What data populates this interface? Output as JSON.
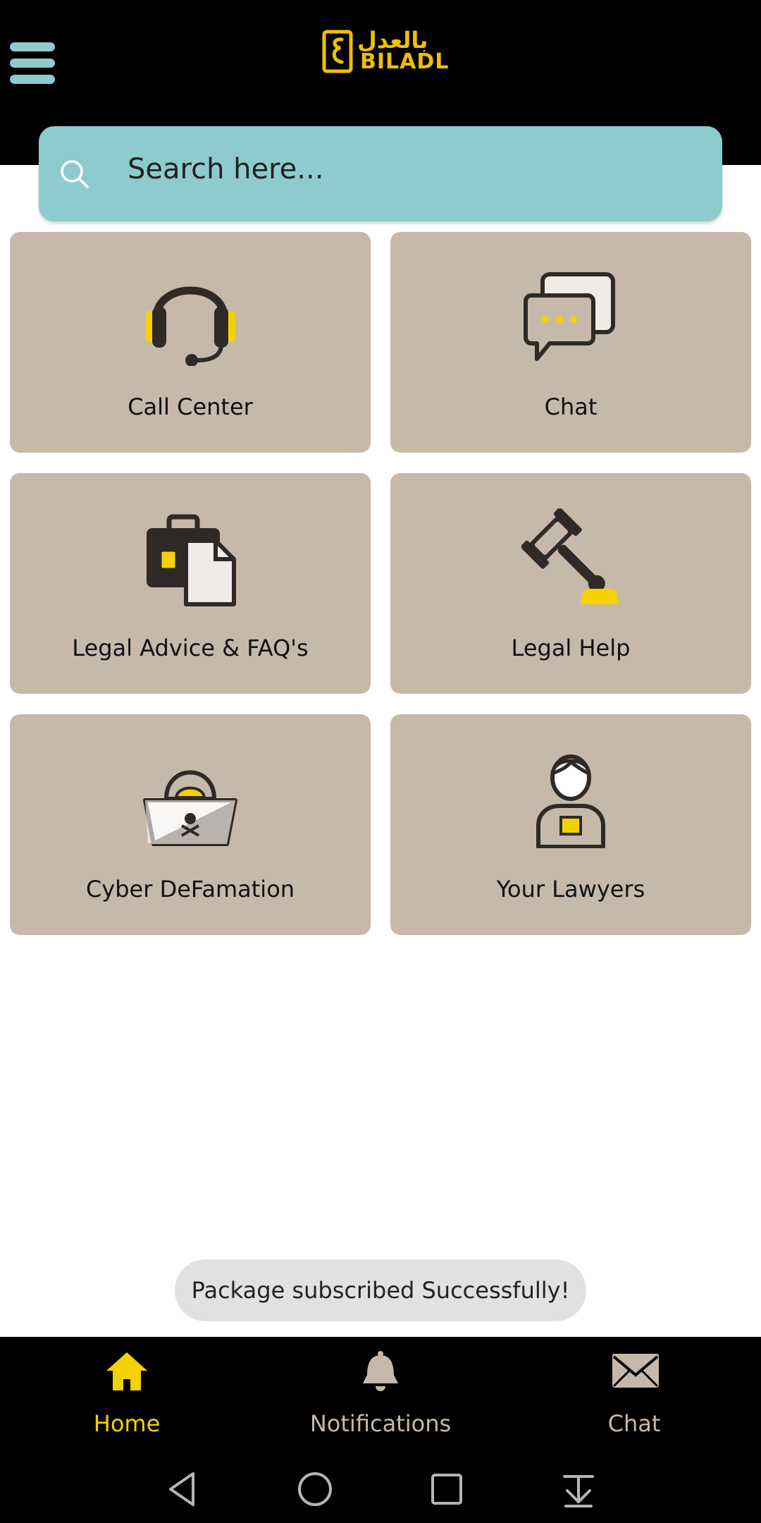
{
  "header": {
    "logo_text": "BILADL",
    "logo_arabic": "بالعدل"
  },
  "search": {
    "placeholder": "Search here..."
  },
  "tiles": [
    {
      "label": "Call Center",
      "icon": "headset-icon"
    },
    {
      "label": "Chat",
      "icon": "chat-bubbles-icon"
    },
    {
      "label": "Legal Advice & FAQ's",
      "icon": "briefcase-document-icon"
    },
    {
      "label": "Legal Help",
      "icon": "gavel-icon"
    },
    {
      "label": "Cyber DeFamation",
      "icon": "hacker-laptop-icon"
    },
    {
      "label": "Your Lawyers",
      "icon": "lawyer-icon"
    }
  ],
  "toast": {
    "message": "Package subscribed Successfully!"
  },
  "bottom_nav": {
    "items": [
      {
        "label": "Home",
        "icon": "home-icon",
        "active": true
      },
      {
        "label": "Notifications",
        "icon": "bell-icon",
        "active": false
      },
      {
        "label": "Chat",
        "icon": "envelope-icon",
        "active": false
      }
    ]
  },
  "colors": {
    "accent": "#f5d100",
    "teal": "#8ecbcf",
    "tile": "#c6b9aa",
    "inactive_nav": "#c6b9aa"
  }
}
